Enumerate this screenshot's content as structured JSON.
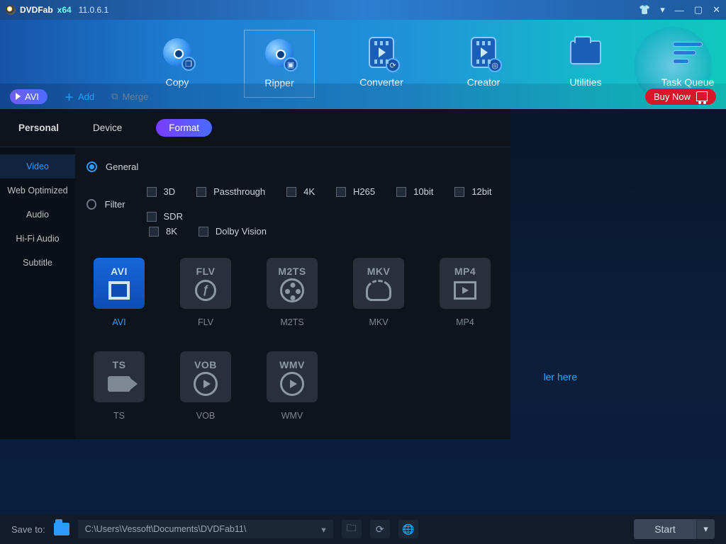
{
  "app": {
    "name": "DVDFab",
    "arch": "x64",
    "version": "11.0.6.1"
  },
  "nav": {
    "items": [
      "Copy",
      "Ripper",
      "Converter",
      "Creator",
      "Utilities",
      "Task Queue"
    ],
    "active": "Ripper"
  },
  "actionStrip": {
    "profile": "AVI",
    "add": "Add",
    "merge": "Merge",
    "buyNow": "Buy Now"
  },
  "hint": "ler here",
  "panel": {
    "tabs": {
      "personal": "Personal",
      "device": "Device",
      "format": "Format",
      "active": "Format"
    },
    "side": {
      "items": [
        "Video",
        "Web Optimized",
        "Audio",
        "Hi-Fi Audio",
        "Subtitle"
      ],
      "active": "Video"
    },
    "mode": {
      "general": "General",
      "filter": "Filter",
      "selected": "General"
    },
    "filters": [
      "3D",
      "Passthrough",
      "4K",
      "H265",
      "10bit",
      "12bit",
      "SDR",
      "8K",
      "Dolby Vision"
    ],
    "formats": [
      {
        "code": "AVI",
        "label": "AVI",
        "selected": true,
        "glyph": "film"
      },
      {
        "code": "FLV",
        "label": "FLV",
        "selected": false,
        "glyph": "flash"
      },
      {
        "code": "M2TS",
        "label": "M2TS",
        "selected": false,
        "glyph": "reel"
      },
      {
        "code": "MKV",
        "label": "MKV",
        "selected": false,
        "glyph": "mkv"
      },
      {
        "code": "MP4",
        "label": "MP4",
        "selected": false,
        "glyph": "mp4"
      },
      {
        "code": "TS",
        "label": "TS",
        "selected": false,
        "glyph": "cam"
      },
      {
        "code": "VOB",
        "label": "VOB",
        "selected": false,
        "glyph": "play"
      },
      {
        "code": "WMV",
        "label": "WMV",
        "selected": false,
        "glyph": "play"
      }
    ]
  },
  "bottom": {
    "saveTo": "Save to:",
    "path": "C:\\Users\\Vessoft\\Documents\\DVDFab11\\",
    "start": "Start"
  }
}
